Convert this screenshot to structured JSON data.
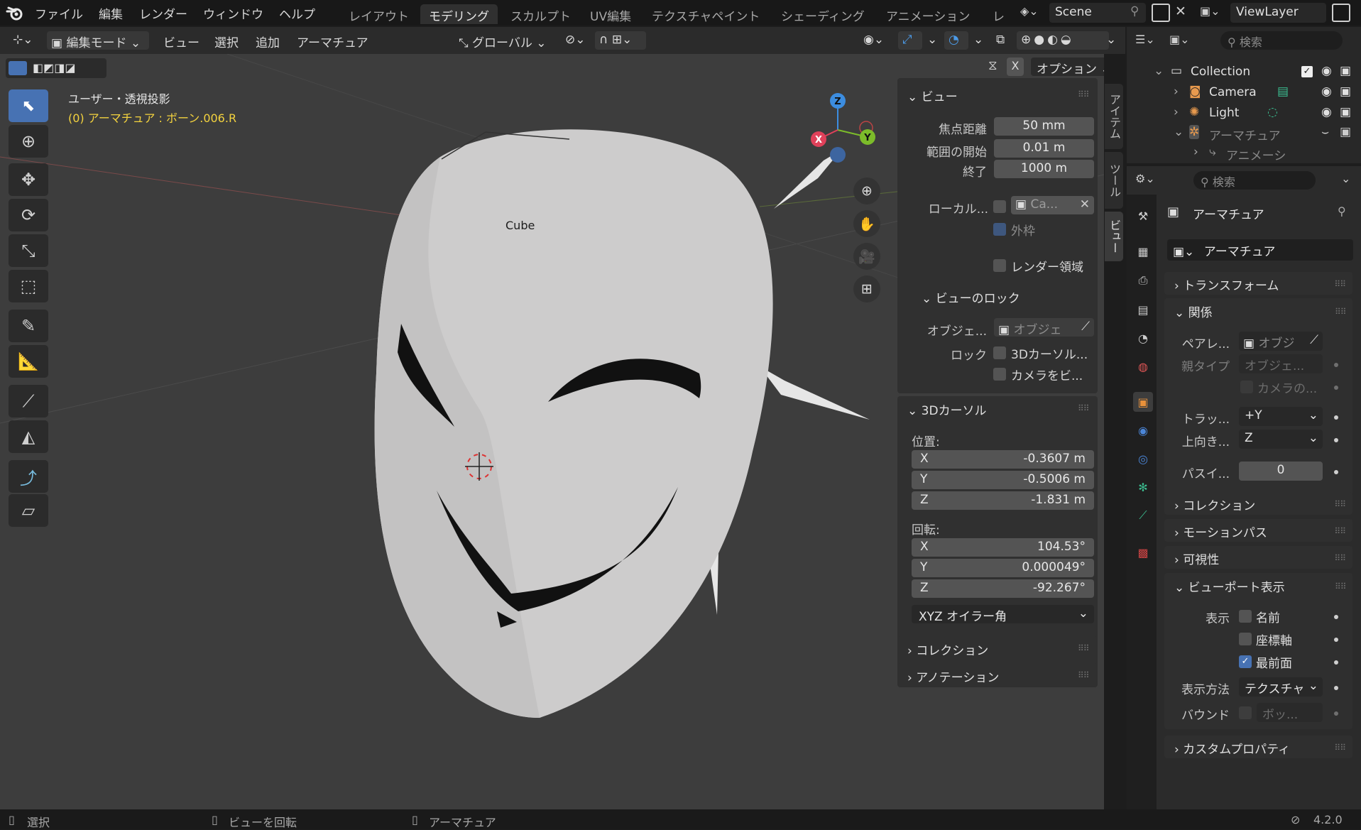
{
  "app": {
    "menus": [
      "ファイル",
      "編集",
      "レンダー",
      "ウィンドウ",
      "ヘルプ"
    ],
    "workspace_tabs": [
      "レイアウト",
      "モデリング",
      "スカルプト",
      "UV編集",
      "テクスチャペイント",
      "シェーディング",
      "アニメーション",
      "レ"
    ],
    "active_workspace": "モデリング",
    "scene_name": "Scene",
    "view_layer": "ViewLayer"
  },
  "header": {
    "mode": "編集モード",
    "menus": [
      "ビュー",
      "選択",
      "追加",
      "アーマチュア"
    ],
    "transform_orientation": "グローバル",
    "options_label": "オプション",
    "axis_x": "X"
  },
  "viewport": {
    "view_name": "ユーザー・透視投影",
    "active_info": "(0) アーマチュア : ボーン.006.R",
    "object_label": "Cube",
    "gizmo": {
      "x": "X",
      "y": "Y",
      "z": "Z"
    }
  },
  "npanel": {
    "tabs": [
      "アイテム",
      "ツール",
      "ビュー"
    ],
    "view_section": "ビュー",
    "focal_label": "焦点距離",
    "focal_value": "50 mm",
    "clip_start_label": "範囲の開始",
    "clip_start_value": "0.01 m",
    "clip_end_label": "終了",
    "clip_end_value": "1000 m",
    "local_camera_label": "ローカル...",
    "local_camera_value": "Ca...",
    "border_label": "外枠",
    "render_region_label": "レンダー領域",
    "view_lock_section": "ビューのロック",
    "lock_object_label": "オブジェ...",
    "lock_object_placeholder": "オブジェ",
    "lock_label": "ロック",
    "lock_cursor_label": "3Dカーソル...",
    "lock_camera_label": "カメラをビ...",
    "cursor_section": "3Dカーソル",
    "location_label": "位置:",
    "loc": [
      {
        "axis": "X",
        "value": "-0.3607 m"
      },
      {
        "axis": "Y",
        "value": "-0.5006 m"
      },
      {
        "axis": "Z",
        "value": "-1.831 m"
      }
    ],
    "rotation_label": "回転:",
    "rot": [
      {
        "axis": "X",
        "value": "104.53°"
      },
      {
        "axis": "Y",
        "value": "0.000049°"
      },
      {
        "axis": "Z",
        "value": "-92.267°"
      }
    ],
    "rotation_mode": "XYZ オイラー角",
    "collection_section": "コレクション",
    "annotation_section": "アノテーション"
  },
  "outliner": {
    "search_placeholder": "検索",
    "rows": [
      "Collection",
      "Camera",
      "Light",
      "アーマチュア",
      "アニメーシ"
    ]
  },
  "properties": {
    "search_placeholder": "検索",
    "object_name": "アーマチュア",
    "datablock_name": "アーマチュア",
    "sections": {
      "transform": "トランスフォーム",
      "relations": "関係",
      "collections": "コレクション",
      "motion_paths": "モーションパス",
      "visibility": "可視性",
      "viewport_display": "ビューポート表示",
      "custom_props": "カスタムプロパティ"
    },
    "parent_label": "ペアレ...",
    "parent_placeholder": "オブジ",
    "parent_type_label": "親タイプ",
    "parent_type_value": "オブジェ...",
    "camera_parent_label": "カメラの...",
    "track_label": "トラッ...",
    "track_value": "+Y",
    "up_label": "上向き...",
    "up_value": "Z",
    "pass_label": "パスイ...",
    "pass_value": "0",
    "show_label": "表示",
    "show_name": "名前",
    "show_axes": "座標軸",
    "show_front": "最前面",
    "display_as_label": "表示方法",
    "display_as_value": "テクスチャ",
    "bounds_label": "バウンド",
    "bounds_value": "ボッ..."
  },
  "status": {
    "select": "選択",
    "rotate_view": "ビューを回転",
    "armature": "アーマチュア",
    "version": "4.2.0"
  }
}
